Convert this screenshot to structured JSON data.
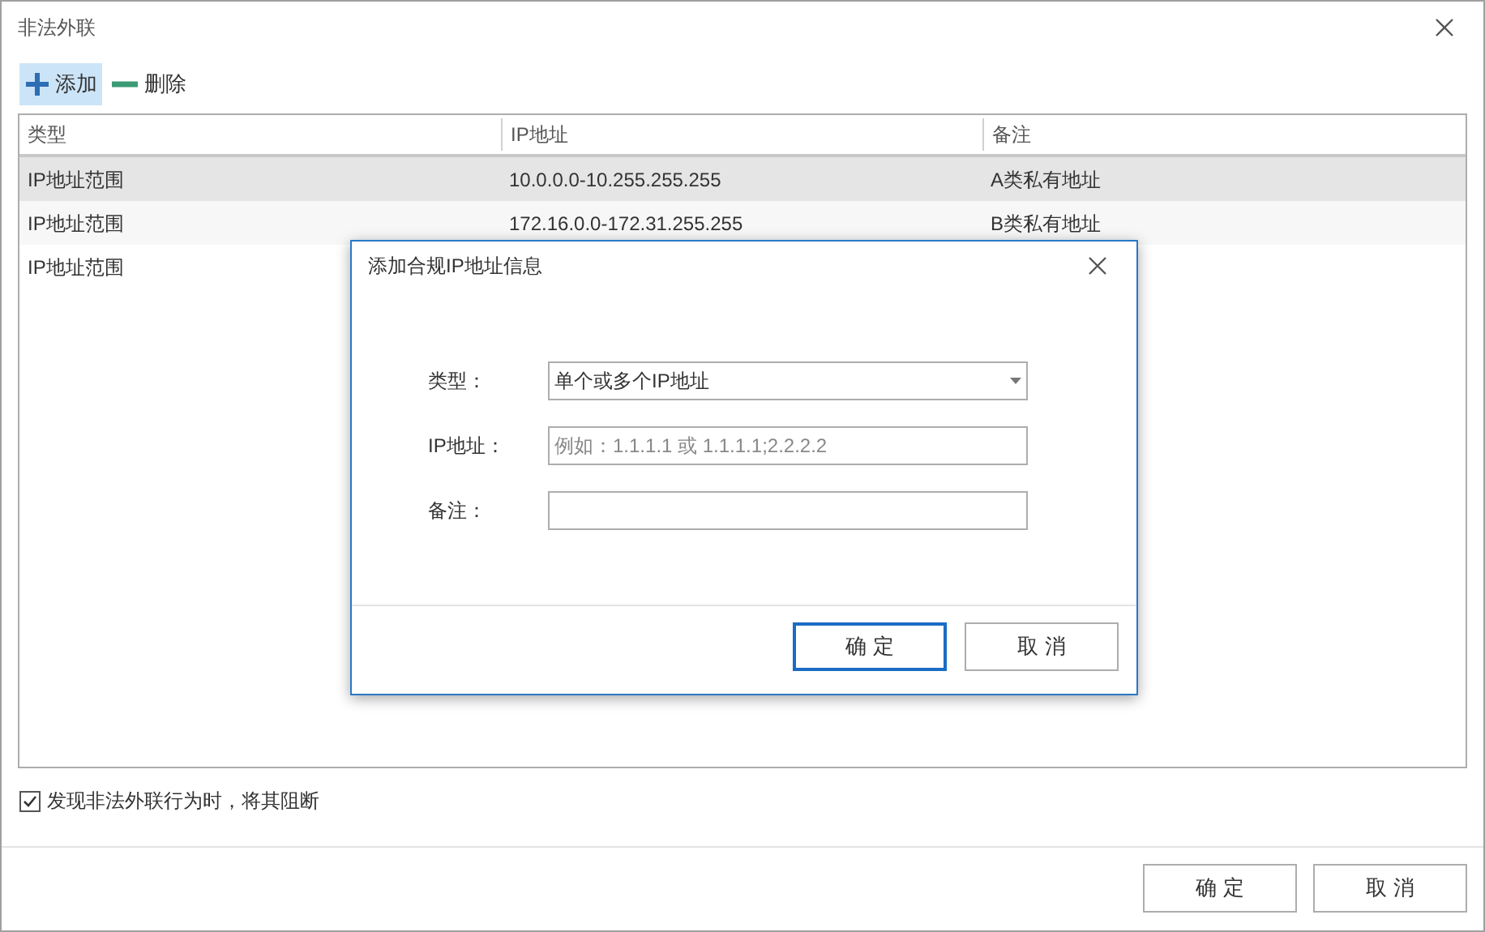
{
  "window": {
    "title": "非法外联"
  },
  "toolbar": [
    {
      "kind": "add",
      "label": "添加",
      "selected": true
    },
    {
      "kind": "remove",
      "label": "删除",
      "selected": false
    }
  ],
  "table": {
    "columns": [
      "类型",
      "IP地址",
      "备注"
    ],
    "rows": [
      {
        "cells": [
          "IP地址范围",
          "10.0.0.0-10.255.255.255",
          "A类私有地址"
        ],
        "selected": true
      },
      {
        "cells": [
          "IP地址范围",
          "172.16.0.0-172.31.255.255",
          "B类私有地址"
        ],
        "selected": false
      },
      {
        "cells": [
          "IP地址范围"
        ],
        "selected": false
      }
    ]
  },
  "block_option": {
    "label": "发现非法外联行为时，将其阻断",
    "checked": true
  },
  "buttons": [
    {
      "label": "确 定"
    },
    {
      "label": "取 消"
    }
  ],
  "dialog": {
    "title": "添加合规IP地址信息",
    "fields": [
      {
        "kind": "select",
        "label": "类型：",
        "value": "单个或多个IP地址"
      },
      {
        "kind": "text",
        "label": "IP地址：",
        "placeholder": "例如：1.1.1.1 或 1.1.1.1;2.2.2.2"
      },
      {
        "kind": "text",
        "label": "备注："
      }
    ],
    "buttons": [
      {
        "label": "确 定",
        "default": true
      },
      {
        "label": "取 消",
        "default": false
      }
    ]
  }
}
